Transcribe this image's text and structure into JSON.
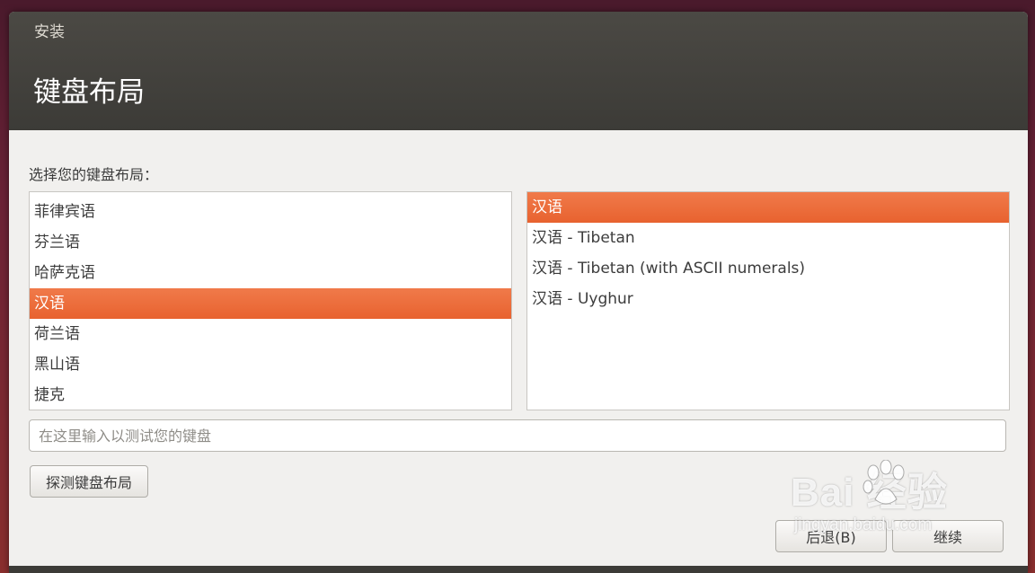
{
  "window": {
    "title": "安装"
  },
  "page": {
    "title": "键盘布局",
    "prompt": "选择您的键盘布局："
  },
  "layouts": [
    {
      "label": "菲律宾语",
      "selected": false
    },
    {
      "label": "芬兰语",
      "selected": false
    },
    {
      "label": "哈萨克语",
      "selected": false
    },
    {
      "label": "汉语",
      "selected": true
    },
    {
      "label": "荷兰语",
      "selected": false
    },
    {
      "label": "黑山语",
      "selected": false
    },
    {
      "label": "捷克",
      "selected": false
    }
  ],
  "variants": [
    {
      "label": "汉语",
      "selected": true
    },
    {
      "label": "汉语 - Tibetan",
      "selected": false
    },
    {
      "label": "汉语 - Tibetan (with ASCII numerals)",
      "selected": false
    },
    {
      "label": "汉语 - Uyghur",
      "selected": false
    }
  ],
  "test_input": {
    "placeholder": "在这里输入以测试您的键盘",
    "value": ""
  },
  "buttons": {
    "detect": "探测键盘布局",
    "back": "后退(B)",
    "continue": "继续"
  },
  "watermark": {
    "main": "Bai 经验",
    "sub": "jingyan.baidu.com"
  },
  "colors": {
    "accent": "#e8622f",
    "titlebar": "#3c3b37"
  }
}
